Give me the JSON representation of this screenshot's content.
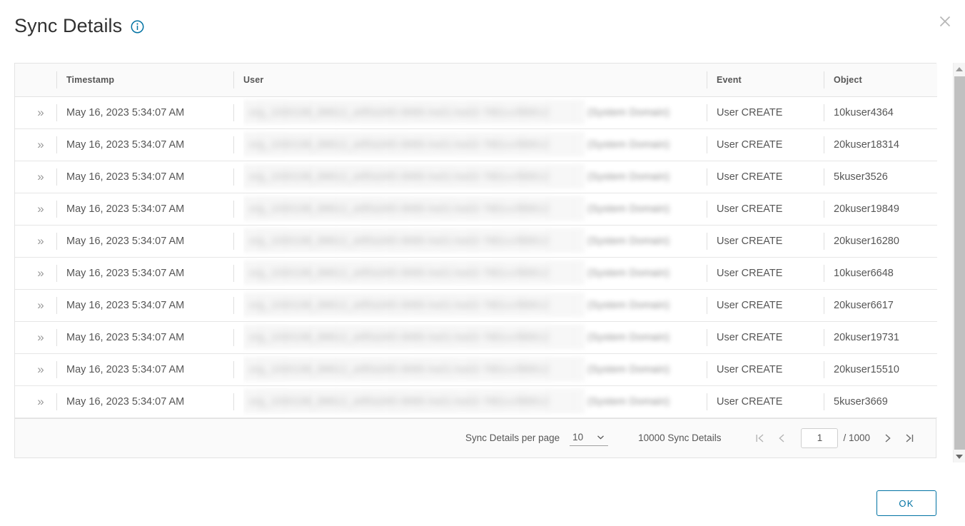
{
  "dialog": {
    "title": "Sync Details",
    "info_icon": "info-circle-icon",
    "close_icon": "close-icon",
    "ok_label": "OK"
  },
  "table": {
    "columns": [
      "",
      "Timestamp",
      "User",
      "Event",
      "Object"
    ],
    "expand_icon": "double-chevron-right-icon",
    "rows": [
      {
        "timestamp": "May 16, 2023 5:34:07 AM",
        "user": "(System Domain)",
        "event": "User CREATE",
        "object": "10kuser4364"
      },
      {
        "timestamp": "May 16, 2023 5:34:07 AM",
        "user": "(System Domain)",
        "event": "User CREATE",
        "object": "20kuser18314"
      },
      {
        "timestamp": "May 16, 2023 5:34:07 AM",
        "user": "(System Domain)",
        "event": "User CREATE",
        "object": "5kuser3526"
      },
      {
        "timestamp": "May 16, 2023 5:34:07 AM",
        "user": "(System Domain)",
        "event": "User CREATE",
        "object": "20kuser19849"
      },
      {
        "timestamp": "May 16, 2023 5:34:07 AM",
        "user": "(System Domain)",
        "event": "User CREATE",
        "object": "20kuser16280"
      },
      {
        "timestamp": "May 16, 2023 5:34:07 AM",
        "user": "(System Domain)",
        "event": "User CREATE",
        "object": "10kuser6648"
      },
      {
        "timestamp": "May 16, 2023 5:34:07 AM",
        "user": "(System Domain)",
        "event": "User CREATE",
        "object": "20kuser6617"
      },
      {
        "timestamp": "May 16, 2023 5:34:07 AM",
        "user": "(System Domain)",
        "event": "User CREATE",
        "object": "20kuser19731"
      },
      {
        "timestamp": "May 16, 2023 5:34:07 AM",
        "user": "(System Domain)",
        "event": "User CREATE",
        "object": "20kuser15510"
      },
      {
        "timestamp": "May 16, 2023 5:34:07 AM",
        "user": "(System Domain)",
        "event": "User CREATE",
        "object": "5kuser3669"
      }
    ]
  },
  "pagination": {
    "per_page_label": "Sync Details per page",
    "per_page_value": "10",
    "total_label": "10000 Sync Details",
    "current_page": "1",
    "page_total": "/ 1000",
    "first_icon": "first-page-icon",
    "prev_icon": "previous-page-icon",
    "next_icon": "next-page-icon",
    "last_icon": "last-page-icon",
    "chevron_icon": "chevron-down-icon"
  },
  "scrollbar": {
    "up_icon": "scroll-up-arrow-icon",
    "down_icon": "scroll-down-arrow-icon"
  },
  "colors": {
    "accent": "#0072a3",
    "text": "#565656",
    "header_bg": "#fafafa",
    "border": "#e3e3e3"
  }
}
